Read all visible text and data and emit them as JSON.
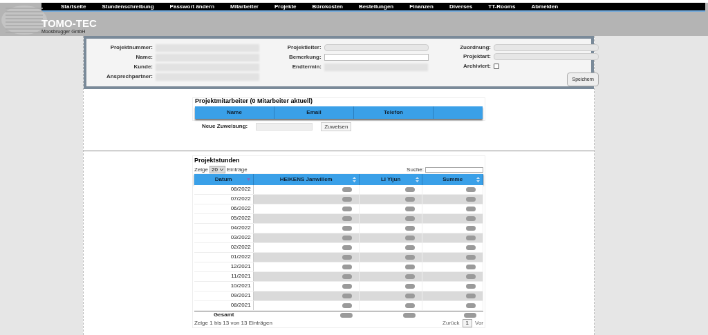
{
  "nav": [
    "Startseite",
    "Stundenschreibung",
    "Passwort ändern",
    "Mitarbeiter",
    "Projekte",
    "Bürokosten",
    "Bestellungen",
    "Finanzen",
    "Diverses",
    "TT-Rooms",
    "Abmelden"
  ],
  "company": {
    "name": "TOMO-TEC",
    "subtitle": "Moosbrugger GmbH"
  },
  "project_form": {
    "columns": [
      [
        {
          "label": "Projektnummer:",
          "kind": "blurred"
        },
        {
          "label": "Name:",
          "kind": "blurred"
        },
        {
          "label": "Kunde:",
          "kind": "blurred"
        },
        {
          "label": "Ansprechpartner:",
          "kind": "blurred"
        }
      ],
      [
        {
          "label": "Projektleiter:",
          "kind": "select"
        },
        {
          "label": "Bemerkung:",
          "kind": "input"
        },
        {
          "label": "Endtermin:",
          "kind": "blurred"
        }
      ],
      [
        {
          "label": "Zuordnung:",
          "kind": "select"
        },
        {
          "label": "Projektart:",
          "kind": "select"
        },
        {
          "label": "Archiviert:",
          "kind": "checkbox",
          "checked": false
        }
      ]
    ],
    "save_button": "Speichern"
  },
  "staff": {
    "title": "Projektmitarbeiter (0 Mitarbeiter aktuell)",
    "columns": [
      "Name",
      "Email",
      "Telefon"
    ],
    "assign_label": "Neue Zuweisung:",
    "assign_button": "Zuweisen"
  },
  "hours": {
    "title": "Projektstunden",
    "show_label": "Zeige",
    "page_size": "20",
    "entries_label": "Einträge",
    "search_label": "Suche:",
    "columns": [
      {
        "label": "Datum",
        "sorted": true
      },
      {
        "label": "HEIKENS Janwillem",
        "sorted": false
      },
      {
        "label": "LI Yijun",
        "sorted": false
      },
      {
        "label": "Summe",
        "sorted": false
      }
    ],
    "rows": [
      {
        "date": "08/2022"
      },
      {
        "date": "07/2022"
      },
      {
        "date": "06/2022"
      },
      {
        "date": "05/2022"
      },
      {
        "date": "04/2022"
      },
      {
        "date": "03/2022"
      },
      {
        "date": "02/2022"
      },
      {
        "date": "01/2022"
      },
      {
        "date": "12/2021"
      },
      {
        "date": "11/2021"
      },
      {
        "date": "10/2021"
      },
      {
        "date": "09/2021"
      },
      {
        "date": "08/2021"
      }
    ],
    "total_label": "Gesamt",
    "info": "Zeige 1 bis 13 von 13 Einträgen",
    "prev": "Zurück",
    "page": "1",
    "next": "Vor"
  }
}
